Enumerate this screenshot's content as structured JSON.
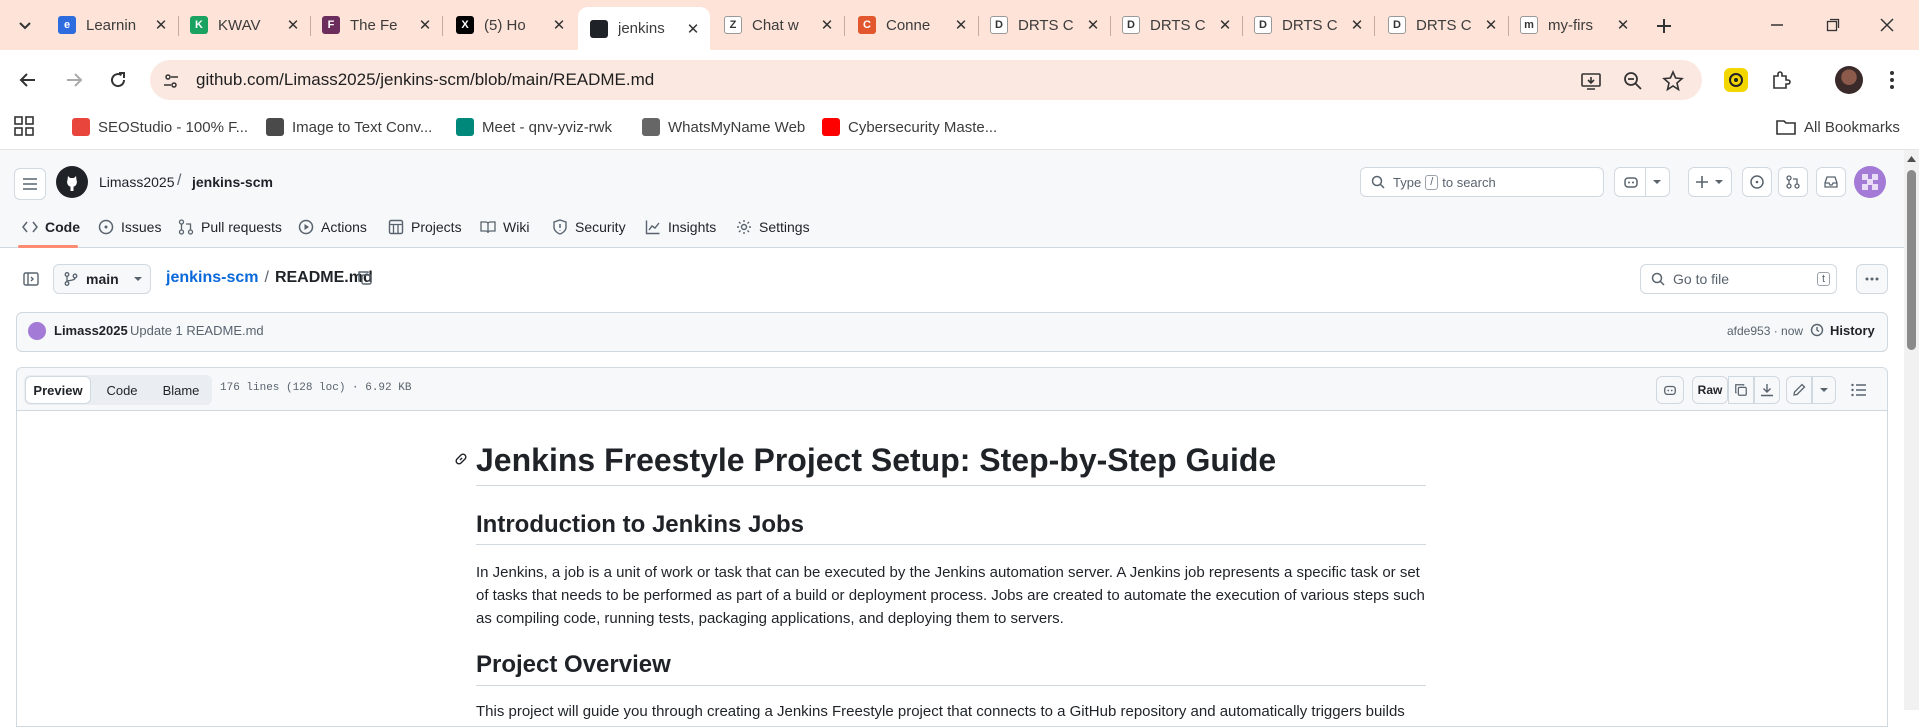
{
  "browser": {
    "tabs": [
      {
        "title": "Learnin",
        "fav_color": "#2d6cdf",
        "fav_glyph": "e"
      },
      {
        "title": "KWAV",
        "fav_color": "#1aa260",
        "fav_glyph": "K"
      },
      {
        "title": "The Fe",
        "fav_color": "#6b2d5c",
        "fav_glyph": "F"
      },
      {
        "title": "(5) Ho",
        "fav_color": "#000000",
        "fav_glyph": "X"
      },
      {
        "title": "jenkins",
        "fav_color": "#1f2328",
        "fav_glyph": "",
        "active": true
      },
      {
        "title": "Chat w",
        "fav_color": "#ffffff",
        "fav_glyph": "Z"
      },
      {
        "title": "Conne",
        "fav_color": "#e2572d",
        "fav_glyph": "C"
      },
      {
        "title": "DRTS C",
        "fav_color": "#ffffff",
        "fav_glyph": "D"
      },
      {
        "title": "DRTS C",
        "fav_color": "#ffffff",
        "fav_glyph": "D"
      },
      {
        "title": "DRTS C",
        "fav_color": "#ffffff",
        "fav_glyph": "D"
      },
      {
        "title": "DRTS C",
        "fav_color": "#ffffff",
        "fav_glyph": "D"
      },
      {
        "title": "my-firs",
        "fav_color": "#ffffff",
        "fav_glyph": "m"
      }
    ],
    "url": "github.com/Limass2025/jenkins-scm/blob/main/README.md",
    "bookmarks": [
      {
        "label": "SEOStudio - 100% F...",
        "color": "#e8453c"
      },
      {
        "label": "Image to Text Conv...",
        "color": "#4a4a4a"
      },
      {
        "label": "Meet - qnv-yviz-rwk",
        "color": "#00897b"
      },
      {
        "label": "WhatsMyName Web",
        "color": "#666666"
      },
      {
        "label": "Cybersecurity Maste...",
        "color": "#ff0000"
      }
    ],
    "all_bookmarks": "All Bookmarks"
  },
  "github": {
    "owner": "Limass2025",
    "repo": "jenkins-scm",
    "search_placeholder_pre": "Type",
    "search_key": "/",
    "search_placeholder_post": "to search",
    "nav_tabs": [
      {
        "label": "Code",
        "icon": "code-icon",
        "active": true
      },
      {
        "label": "Issues",
        "icon": "issue-icon"
      },
      {
        "label": "Pull requests",
        "icon": "pull-request-icon"
      },
      {
        "label": "Actions",
        "icon": "actions-icon"
      },
      {
        "label": "Projects",
        "icon": "projects-icon"
      },
      {
        "label": "Wiki",
        "icon": "wiki-icon"
      },
      {
        "label": "Security",
        "icon": "shield-icon"
      },
      {
        "label": "Insights",
        "icon": "graph-icon"
      },
      {
        "label": "Settings",
        "icon": "gear-icon"
      }
    ],
    "branch": "main",
    "breadcrumb_repo": "jenkins-scm",
    "breadcrumb_sep": "/",
    "breadcrumb_file": "README.md",
    "goto_file_placeholder": "Go to file",
    "goto_file_key": "t",
    "commit": {
      "author": "Limass2025",
      "message": "Update 1 README.md",
      "sha_time": "afde953 · now",
      "history": "History"
    },
    "file_tabs": [
      "Preview",
      "Code",
      "Blame"
    ],
    "file_meta": "176 lines (128 loc) · 6.92 KB",
    "raw_label": "Raw"
  },
  "readme": {
    "h1": "Jenkins Freestyle Project Setup: Step-by-Step Guide",
    "h2_intro": "Introduction to Jenkins Jobs",
    "p_intro": "In Jenkins, a job is a unit of work or task that can be executed by the Jenkins automation server. A Jenkins job represents a specific task or set of tasks that needs to be performed as part of a build or deployment process. Jobs are created to automate the execution of various steps such as compiling code, running tests, packaging applications, and deploying them to servers.",
    "h2_overview": "Project Overview",
    "p_overview": "This project will guide you through creating a Jenkins Freestyle project that connects to a GitHub repository and automatically triggers builds"
  }
}
